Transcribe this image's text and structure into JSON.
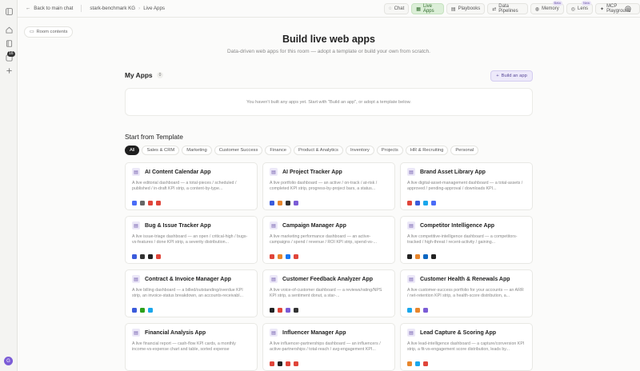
{
  "rail": {
    "badge": "16",
    "avatar": "G"
  },
  "breadcrumb": {
    "back": "Back to main chat",
    "workspace": "stark-benchmark KG",
    "page": "Live Apps"
  },
  "nav": [
    {
      "label": "Chat",
      "icon": "chat-icon",
      "active": false,
      "badge": ""
    },
    {
      "label": "Live Apps",
      "icon": "apps-icon",
      "active": true,
      "badge": ""
    },
    {
      "label": "Playbooks",
      "icon": "book-icon",
      "active": false,
      "badge": ""
    },
    {
      "label": "Data Pipelines",
      "icon": "pipeline-icon",
      "active": false,
      "badge": ""
    },
    {
      "label": "Memory",
      "icon": "memory-icon",
      "active": false,
      "badge": "Beta"
    },
    {
      "label": "Lens",
      "icon": "lens-icon",
      "active": false,
      "badge": "New"
    },
    {
      "label": "MCP Playground",
      "icon": "mcp-icon",
      "active": false,
      "badge": ""
    }
  ],
  "room_contents": "Room contents",
  "hero": {
    "title": "Build live web apps",
    "subtitle": "Data-driven web apps for this room — adopt a template or build your own from scratch."
  },
  "my_apps": {
    "title": "My Apps",
    "count": "0",
    "build_label": "Build an app",
    "empty": "You haven't built any apps yet. Start with \"Build an app\", or adopt a template below."
  },
  "templates": {
    "title": "Start from Template",
    "filters": [
      "All",
      "Sales & CRM",
      "Marketing",
      "Customer Success",
      "Finance",
      "Product & Analytics",
      "Inventory",
      "Projects",
      "HR & Recruiting",
      "Personal"
    ],
    "active_filter": 0,
    "cards": [
      {
        "title": "AI Content Calendar App",
        "desc": "A live editorial dashboard — a total-pieces / scheduled / published / in-draft KPI strip, a content-by-type...",
        "logos": [
          "#4a6cf7",
          "#666",
          "#e0453a",
          "#e0453a"
        ]
      },
      {
        "title": "AI Project Tracker App",
        "desc": "A live portfolio dashboard — an active / on-track / at-risk / completed KPI strip, progress-by-project bars, a status...",
        "logos": [
          "#3b5bdb",
          "#e8862c",
          "#333",
          "#7b5cd6"
        ]
      },
      {
        "title": "Brand Asset Library App",
        "desc": "A live digital-asset-management dashboard — a total-assets / approved / pending-approval / downloads KPI...",
        "logos": [
          "#e0453a",
          "#3b5bdb",
          "#1aa7ec",
          "#4a6cf7"
        ]
      },
      {
        "title": "Bug & Issue Tracker App",
        "desc": "A live issue-triage dashboard — an open / critical-high / bugs-vs-features / done KPI strip, a severity distribution...",
        "logos": [
          "#3b5bdb",
          "#333",
          "#222",
          "#e0453a"
        ]
      },
      {
        "title": "Campaign Manager App",
        "desc": "A live marketing performance dashboard — an active-campaigns / spend / revenue / ROI KPI strip, spend-vs-...",
        "logos": [
          "#e0453a",
          "#e8862c",
          "#1877f2",
          "#e0453a"
        ]
      },
      {
        "title": "Competitor Intelligence App",
        "desc": "A live competitive-intelligence dashboard — a competitors-tracked / high-threat / recent-activity / gaining...",
        "logos": [
          "#222",
          "#e8862c",
          "#0a66c2",
          "#222"
        ]
      },
      {
        "title": "Contract & Invoice Manager App",
        "desc": "A live billing dashboard — a billed/outstanding/overdue KPI strip, an invoice-status breakdown, an accounts-receivabl...",
        "logos": [
          "#3b5bdb",
          "#2ca01c",
          "#1aa7ec"
        ]
      },
      {
        "title": "Customer Feedback Analyzer App",
        "desc": "A live voice-of-customer dashboard — a reviews/rating/NPS KPI strip, a sentiment donut, a star-...",
        "logos": [
          "#222",
          "#e0453a",
          "#7b5cd6",
          "#333"
        ]
      },
      {
        "title": "Customer Health & Renewals App",
        "desc": "A live customer-success portfolio for your accounts — an ARR / net-retention KPI strip, a health-score distribution, a...",
        "logos": [
          "#1aa7ec",
          "#e8862c",
          "#7b5cd6"
        ]
      },
      {
        "title": "Financial Analysis App",
        "desc": "A live financial report — cash-flow KPI cards, a monthly income-vs-expense chart and table, sorted expense categories, and income by source — bound to your room's...",
        "logos": []
      },
      {
        "title": "Influencer Manager App",
        "desc": "A live influencer-partnerships dashboard — an influencers / active-partnerships / total-reach / avg-engagement KPI...",
        "logos": [
          "#e0453a",
          "#222",
          "#e0453a",
          "#e0453a"
        ]
      },
      {
        "title": "Lead Capture & Scoring App",
        "desc": "A live lead-intelligence dashboard — a capture/conversion KPI strip, a fit-vs-engagement score distribution, leads by...",
        "logos": [
          "#e8862c",
          "#1aa7ec",
          "#e0453a"
        ]
      }
    ]
  }
}
